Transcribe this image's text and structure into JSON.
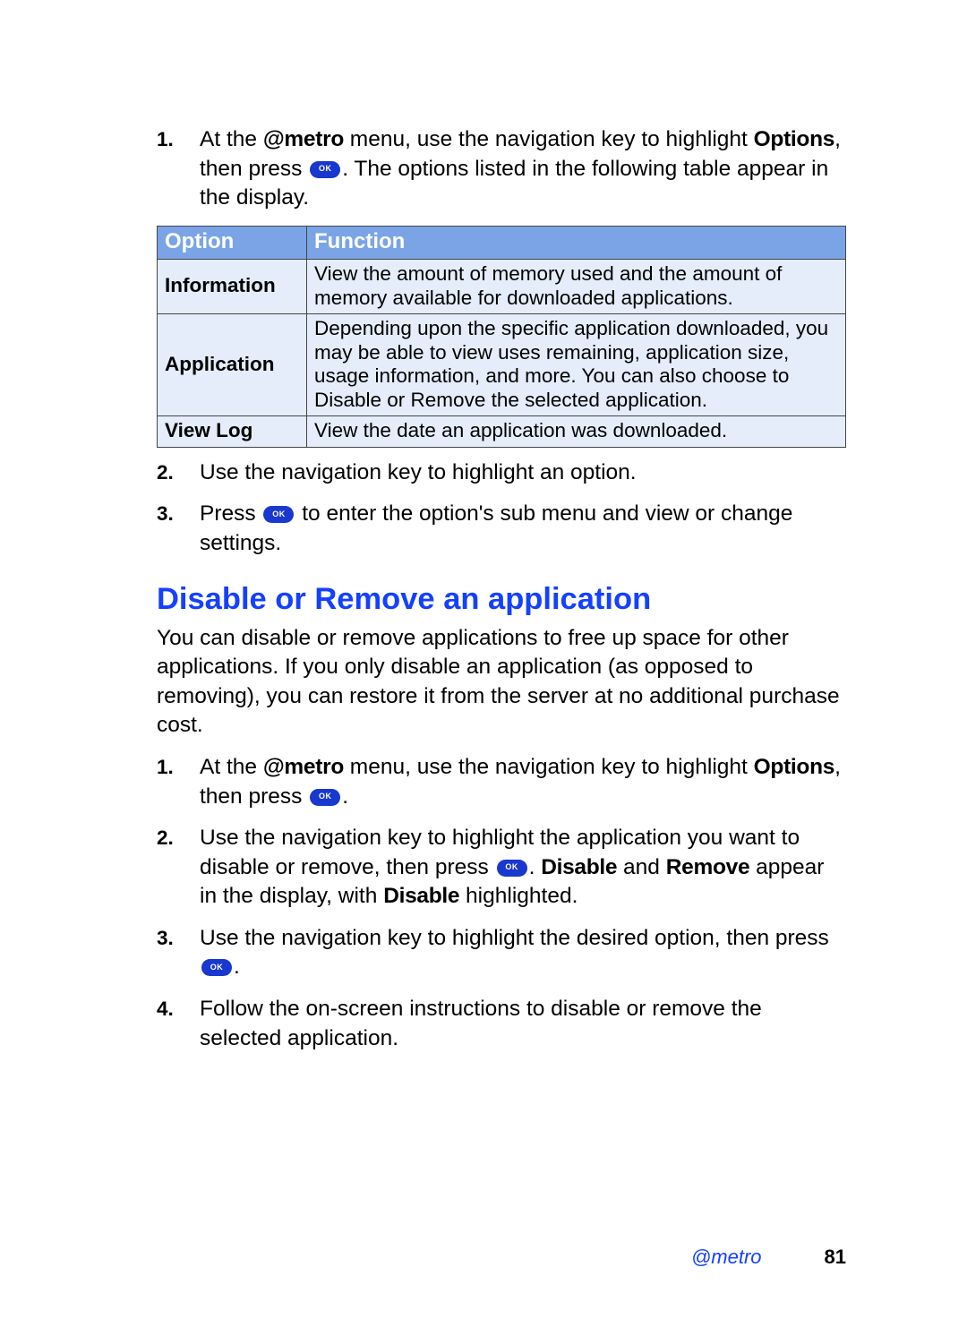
{
  "steps_a": {
    "s1": {
      "num": "1.",
      "t1": "At the ",
      "brand": "@metro",
      "t2": " menu, use the navigation key to highlight ",
      "opt": "Options",
      "t3": ", then press ",
      "t4": ". The options listed in the following table appear in the display."
    },
    "s2": {
      "num": "2.",
      "text": "Use the navigation key to highlight an option."
    },
    "s3": {
      "num": "3.",
      "t1": "Press ",
      "t2": " to enter the option's sub menu and view or change settings."
    }
  },
  "table": {
    "head_option": "Option",
    "head_function": "Function",
    "rows": [
      {
        "opt": "Information",
        "func": "View the amount of memory used and the amount of memory available for downloaded applications."
      },
      {
        "opt": "Application",
        "func": "Depending upon the specific application downloaded, you may be able to view uses remaining, application size, usage information, and more. You can also choose to Disable or Remove the selected application."
      },
      {
        "opt": "View Log",
        "func": "View the date an application was downloaded."
      }
    ]
  },
  "section_heading": "Disable or Remove an application",
  "section_intro": "You can disable or remove applications to free up space for other applications. If you only disable an application (as opposed to removing), you can restore it from the server at no additional purchase cost.",
  "steps_b": {
    "s1": {
      "num": "1.",
      "t1": "At the ",
      "brand": "@metro",
      "t2": " menu, use the navigation key to highlight ",
      "opt": "Options",
      "t3": ", then press ",
      "t4": "."
    },
    "s2": {
      "num": "2.",
      "t1": "Use the navigation key to highlight the application you want to disable or remove, then press ",
      "t2": ". ",
      "disable": "Disable",
      "t3": " and ",
      "remove": "Remove",
      "t4": " appear in the display, with ",
      "disable2": "Disable",
      "t5": " highlighted."
    },
    "s3": {
      "num": "3.",
      "t1": "Use the navigation key to highlight the desired option, then press ",
      "t2": "."
    },
    "s4": {
      "num": "4.",
      "text": "Follow the on-screen instructions to disable or remove the selected application."
    }
  },
  "footer": {
    "section": "@metro",
    "page": "81"
  }
}
